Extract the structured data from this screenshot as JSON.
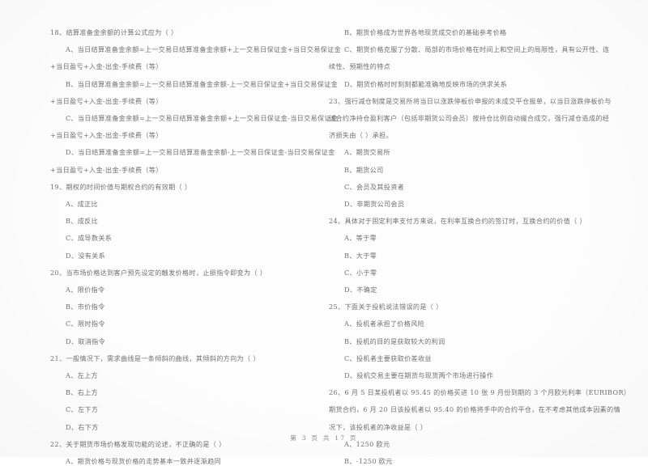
{
  "document": {
    "type": "exam-paper",
    "language": "zh-CN",
    "footer": "第 3 页 共 17 页"
  },
  "left_column": [
    {
      "kind": "question",
      "text": "18、结算准备金余额的计算公式应为（        ）"
    },
    {
      "kind": "option",
      "text": "A、当日结算准备金余额=上一交易日结算准备金余额+上一交易日保证金+当日交易保证金"
    },
    {
      "kind": "continue",
      "text": "+当日盈亏+入金-出金-手续费（等）"
    },
    {
      "kind": "option",
      "text": "B、当日结算准备金余额=上一交易日结算准备金余额-上一交易日保证金+当日交易保证金"
    },
    {
      "kind": "continue",
      "text": "+当日盈亏+入金-出金-手续费（等）"
    },
    {
      "kind": "option",
      "text": "C、当日结算准备金余额=上一交易日结算准备金余额+上一交易日保证金-当日交易保证金"
    },
    {
      "kind": "continue",
      "text": "+当日盈亏+入金-出金-手续费（等）"
    },
    {
      "kind": "option",
      "text": "D、当日结算准备金余额=上一交易日结算准备金余额-上一交易日保证金-当日交易保证金"
    },
    {
      "kind": "continue",
      "text": "+当日盈亏+入金-出金-手续费（等）"
    },
    {
      "kind": "question",
      "text": "19、期权的时间价值与期权合约的有效期（        ）"
    },
    {
      "kind": "option",
      "text": "A、成正比"
    },
    {
      "kind": "option",
      "text": "B、成反比"
    },
    {
      "kind": "option",
      "text": "C、成导数关系"
    },
    {
      "kind": "option",
      "text": "D、没有关系"
    },
    {
      "kind": "question",
      "text": "20、当市场价格达到客户预先设定的触发价格时，止损指令即变为（        ）"
    },
    {
      "kind": "option",
      "text": "A、限价指令"
    },
    {
      "kind": "option",
      "text": "B、市价指令"
    },
    {
      "kind": "option",
      "text": "C、限时指令"
    },
    {
      "kind": "option",
      "text": "D、取消指令"
    },
    {
      "kind": "question",
      "text": "21、一般情况下，需求曲线是一条倾斜的曲线，其倾斜的方向为（        ）"
    },
    {
      "kind": "option",
      "text": "A、左上方"
    },
    {
      "kind": "option",
      "text": "B、右上方"
    },
    {
      "kind": "option",
      "text": "C、左下方"
    },
    {
      "kind": "option",
      "text": "D、右下方"
    },
    {
      "kind": "question",
      "text": "22、关于期货市场价格发现功能的论述，不正确的是（        ）"
    },
    {
      "kind": "option",
      "text": "A、期货价格与现货价格的走势基本一致并逐渐趋同"
    }
  ],
  "right_column": [
    {
      "kind": "option",
      "text": "B、期货价格成为世界各地现货成交价的基础参考价格"
    },
    {
      "kind": "option",
      "text": "C、期货价格克服了分散、局部的市场价格在时间上和空间上的局限性，具有公开性、连"
    },
    {
      "kind": "continue",
      "text": "续性、预期性的特点"
    },
    {
      "kind": "option",
      "text": "D、期货价格时时刻刻都能准确地反映市场的供求关系"
    },
    {
      "kind": "question",
      "text": "23、强行减仓制度是交易所将当日以涨跌停板价申报的未成交平仓报单，以当日涨跌停板价与"
    },
    {
      "kind": "continue",
      "text": "该合约净持仓盈利客户（包括非期货公司会员）按持仓比例自动撮合成交。强行减仓造成的经"
    },
    {
      "kind": "continue",
      "text": "济损失由（        ）承担。"
    },
    {
      "kind": "option",
      "text": "A、期货交易所"
    },
    {
      "kind": "option",
      "text": "B、期货公司"
    },
    {
      "kind": "option",
      "text": "C、会员及其投资者"
    },
    {
      "kind": "option",
      "text": "D、非期货公司会员"
    },
    {
      "kind": "question",
      "text": "24、具体对于固定利率支付方来说，在利率互换合约的签订时，互换合约的价值（        ）"
    },
    {
      "kind": "option",
      "text": "A、等于零"
    },
    {
      "kind": "option",
      "text": "B、大于零"
    },
    {
      "kind": "option",
      "text": "C、小于零"
    },
    {
      "kind": "option",
      "text": "D、不确定"
    },
    {
      "kind": "question",
      "text": "25、下面关于投机说法错误的是（        ）"
    },
    {
      "kind": "option",
      "text": "A、投机者承担了价格风险"
    },
    {
      "kind": "option",
      "text": "B、投机的目的是获取较大的利润"
    },
    {
      "kind": "option",
      "text": "C、投机者主要获取价差收益"
    },
    {
      "kind": "option",
      "text": "D、投机交易主要在期货与现货两个市场进行操作"
    },
    {
      "kind": "question",
      "text": "26、6 月 5 日某投机者以 95.45 的价格买进 10 张 9 月份到期的 3 个月欧元利率（EURIBOR）"
    },
    {
      "kind": "continue",
      "text": "期货合约，6 月 20 日该投机者以 95.40 的价格将手中的合约平仓，在不考虑其他成本因素的情"
    },
    {
      "kind": "continue",
      "text": "况下，该投机者的净收益是（        ）"
    },
    {
      "kind": "option",
      "text": "A、1250 欧元"
    },
    {
      "kind": "option",
      "text": "B、-1250 欧元"
    }
  ]
}
